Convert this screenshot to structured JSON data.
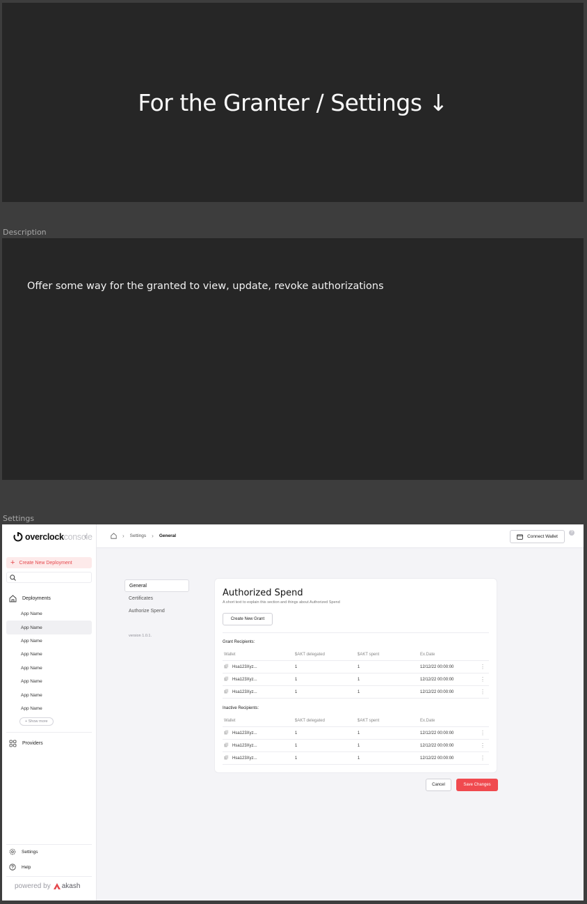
{
  "frames": {
    "description_label": "Description",
    "settings_label": "Settings"
  },
  "hero": {
    "title": "For the Granter / Settings ↓"
  },
  "description": {
    "text": "Offer some way for the granted to view, update, revoke authorizations"
  },
  "sidebar": {
    "brand_name": "overclock",
    "brand_sub": "console",
    "create_label": "Create New Deployment",
    "search_placeholder": "",
    "deployments_label": "Deployments",
    "apps": [
      "App Name",
      "App Name",
      "App Name",
      "App Name",
      "App Name",
      "App Name",
      "App Name",
      "App Name"
    ],
    "active_app_index": 1,
    "show_more_label": "+ Show more",
    "providers_label": "Providers",
    "settings_label": "Settings",
    "help_label": "Help",
    "powered_prefix": "powered by",
    "powered_brand": "akash"
  },
  "topbar": {
    "breadcrumb": [
      "Settings",
      "General"
    ],
    "wallet_label": "Connect Wallet",
    "help_glyph": "?"
  },
  "subnav": {
    "items": [
      "General",
      "Certificates",
      "Authorize Spend"
    ],
    "active_index": 0,
    "version": "version 1.0.1."
  },
  "card": {
    "title": "Authorized Spend",
    "subtitle": "A short text to explain this section and things about Authorized Spend",
    "create_grant_label": "Create New Grant",
    "columns": [
      "Wallet",
      "$AKT delegated",
      "$AKT spent",
      "Ex.Date"
    ],
    "grant_label": "Grant Recipients:",
    "grant_rows": [
      {
        "wallet": "Hsa123Xyz...",
        "delegated": "1",
        "spent": "1",
        "date": "12/12/22 00:00:00"
      },
      {
        "wallet": "Hsa123Xyz...",
        "delegated": "1",
        "spent": "1",
        "date": "12/12/22 00:00:00"
      },
      {
        "wallet": "Hsa123Xyz...",
        "delegated": "1",
        "spent": "1",
        "date": "12/12/22 00:00:00"
      }
    ],
    "inactive_label": "Inactive Recipients:",
    "inactive_rows": [
      {
        "wallet": "Hsa123Xyz...",
        "delegated": "1",
        "spent": "1",
        "date": "12/12/22 00:00:00"
      },
      {
        "wallet": "Hsa123Xyz...",
        "delegated": "1",
        "spent": "1",
        "date": "12/12/22 00:00:00"
      },
      {
        "wallet": "Hsa123Xyz...",
        "delegated": "1",
        "spent": "1",
        "date": "12/12/22 00:00:00"
      }
    ],
    "more_glyph": "⋮"
  },
  "actions": {
    "cancel_label": "Cancel",
    "save_label": "Save Changes"
  },
  "colors": {
    "accent": "#f04a4f",
    "dark_panel": "#262626",
    "canvas": "#3d3d3d"
  }
}
